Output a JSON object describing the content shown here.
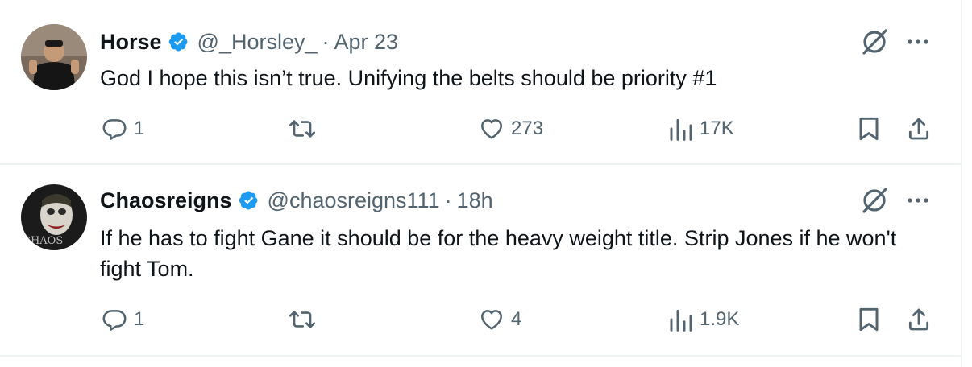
{
  "tweets": [
    {
      "display_name": "Horse",
      "verified": true,
      "handle": "@_Horsley_",
      "separator": "·",
      "time": "Apr 23",
      "text": "God I hope this isn’t true. Unifying the belts should be priority #1",
      "replies": "1",
      "retweets": "",
      "likes": "273",
      "views": "17K"
    },
    {
      "display_name": "Chaosreigns",
      "verified": true,
      "handle": "@chaosreigns111",
      "separator": "·",
      "time": "18h",
      "text": "If he has to fight Gane it should be for the heavy weight title.  Strip Jones if he won't fight Tom.",
      "replies": "1",
      "retweets": "",
      "likes": "4",
      "views": "1.9K",
      "avatar_text": "CHAOS"
    }
  ],
  "colors": {
    "text_primary": "#0f1419",
    "text_secondary": "#536471",
    "verified_blue": "#1d9bf0",
    "divider": "#eff3f4"
  },
  "icons": {
    "verified": "verified-badge-icon",
    "grok": "grok-icon",
    "more": "more-icon",
    "reply": "reply-icon",
    "retweet": "retweet-icon",
    "like": "like-icon",
    "views": "views-icon",
    "bookmark": "bookmark-icon",
    "share": "share-icon"
  }
}
